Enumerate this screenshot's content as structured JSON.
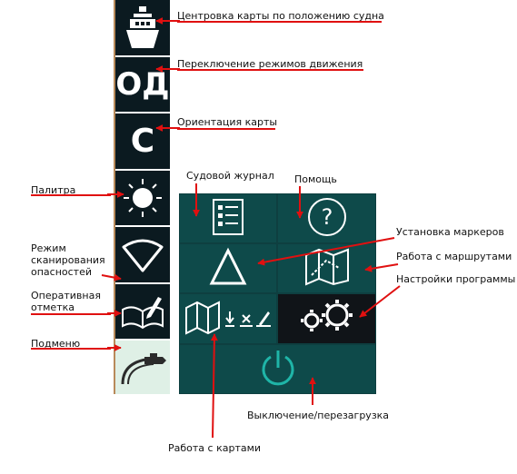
{
  "sidebar": {
    "items": [
      {
        "id": "center-ship",
        "icon": "ship-icon"
      },
      {
        "id": "motion-mode",
        "text": "ОД"
      },
      {
        "id": "orientation",
        "text": "С"
      },
      {
        "id": "palette",
        "icon": "sun-icon"
      },
      {
        "id": "danger-scan",
        "icon": "radar-sector-icon"
      },
      {
        "id": "quick-mark",
        "icon": "book-pen-icon"
      },
      {
        "id": "submenu",
        "icon": "ship-wake-icon"
      }
    ]
  },
  "submenu_panel": {
    "items": [
      {
        "id": "logbook",
        "icon": "checklist-icon"
      },
      {
        "id": "help",
        "icon": "question-circle-icon"
      },
      {
        "id": "markers",
        "icon": "triangle-icon"
      },
      {
        "id": "routes",
        "icon": "map-route-icon"
      },
      {
        "id": "charts",
        "icon": "map-tools-icon"
      },
      {
        "id": "settings",
        "icon": "gears-icon"
      },
      {
        "id": "power",
        "icon": "power-icon"
      }
    ]
  },
  "annotations": {
    "center_ship": "Центровка карты по положению судна",
    "motion_mode": "Переключение режимов движения",
    "orientation": "Ориентация карты",
    "palette": "Палитра",
    "danger_scan": "Режим сканирования опасностей",
    "quick_mark": "Оперативная отметка",
    "submenu": "Подменю",
    "logbook": "Судовой журнал",
    "help": "Помощь",
    "markers": "Установка маркеров",
    "routes": "Работа с маршрутами",
    "settings": "Настройки программы",
    "power": "Выключение/перезагрузка",
    "charts": "Работа с картами"
  },
  "colors": {
    "sidebar_bg": "#0b1a20",
    "panel_bg": "#0e4a4a",
    "settings_bg": "#101418",
    "arrow": "#e01010",
    "power_icon": "#1fb5a8"
  }
}
